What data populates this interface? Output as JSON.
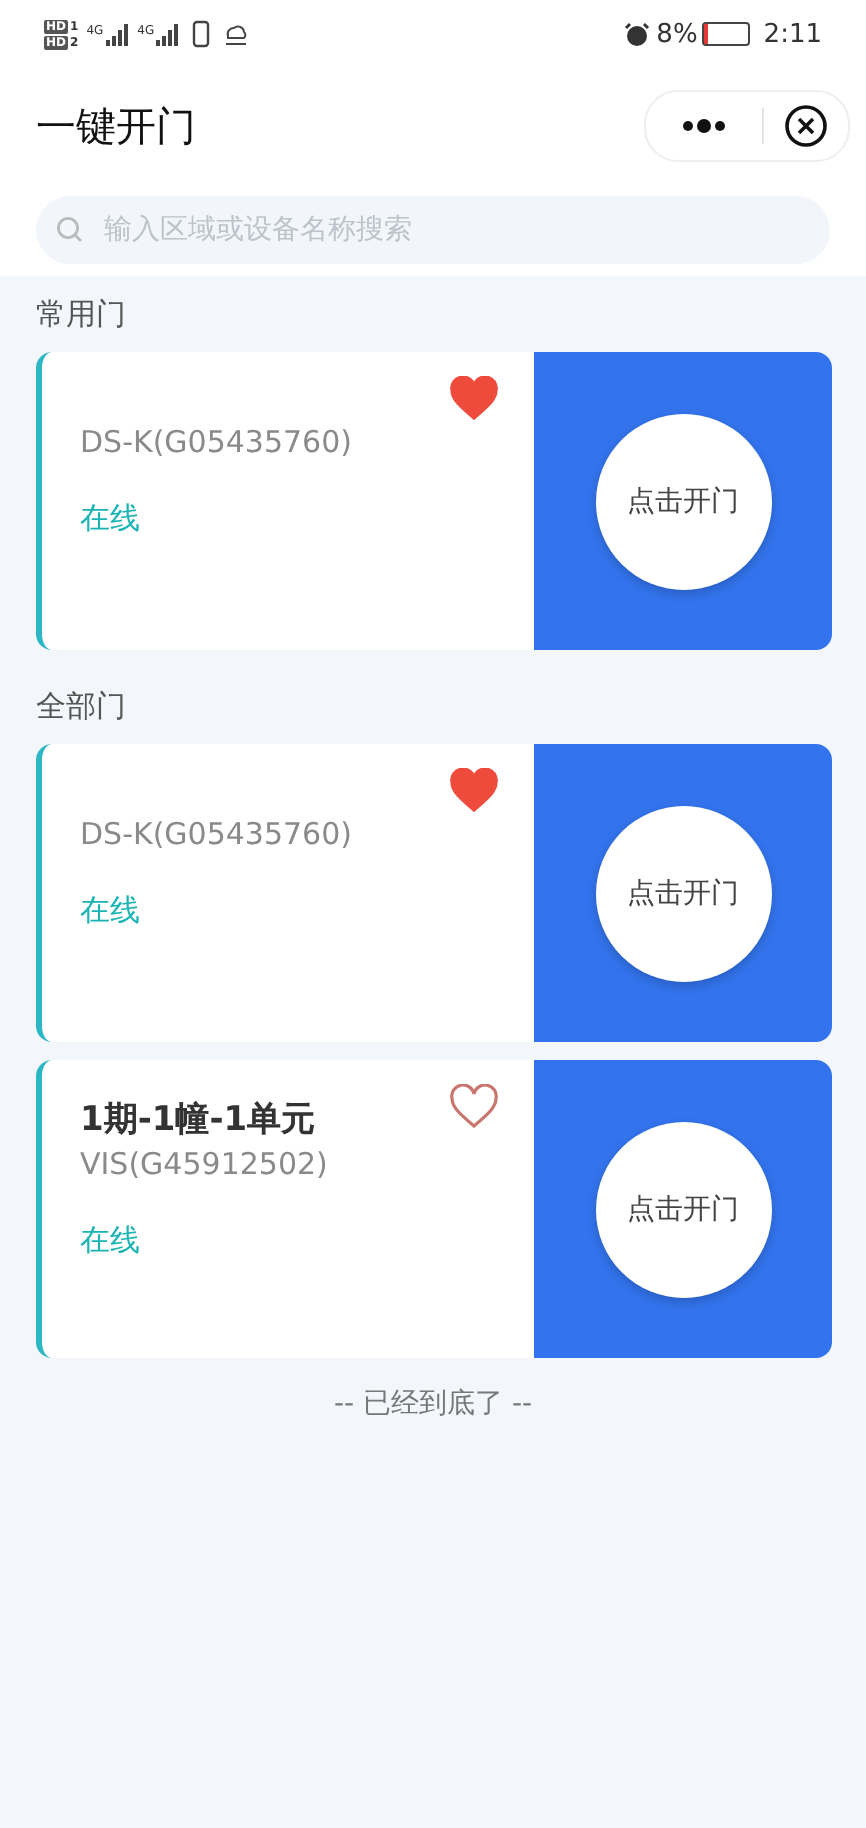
{
  "status_bar": {
    "sims": [
      {
        "badge": "HD",
        "slot": "1",
        "network": "4G"
      },
      {
        "badge": "HD",
        "slot": "2",
        "network": "4G"
      }
    ],
    "battery": "8%",
    "time": "2:11"
  },
  "header": {
    "title": "一键开门"
  },
  "search": {
    "placeholder": "输入区域或设备名称搜索"
  },
  "sections": [
    {
      "title": "常用门",
      "doors": [
        {
          "device": "DS-K(G05435760)",
          "status": "在线",
          "favorite": true,
          "button": "点击开门"
        }
      ]
    },
    {
      "title": "全部门",
      "doors": [
        {
          "device": "DS-K(G05435760)",
          "status": "在线",
          "favorite": true,
          "button": "点击开门"
        },
        {
          "name": "1期-1幢-1单元",
          "device": "VIS(G45912502)",
          "status": "在线",
          "favorite": false,
          "button": "点击开门"
        }
      ]
    }
  ],
  "footer": "-- 已经到底了 --"
}
